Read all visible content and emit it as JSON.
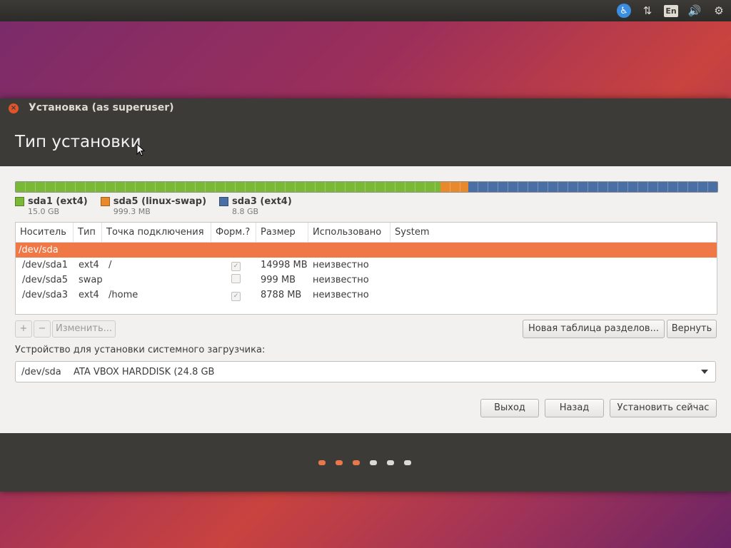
{
  "tray": {
    "accessibility_icon": "accessibility-icon",
    "network_icon": "network-arrows-icon",
    "language": "En",
    "volume_icon": "volume-icon",
    "settings_icon": "gear-icon"
  },
  "window": {
    "title": "Установка (as superuser)",
    "page_title": "Тип установки"
  },
  "partitions": [
    {
      "label": "sda1 (ext4)",
      "size": "15.0 GB",
      "color": "#7ab935",
      "fraction": 0.605
    },
    {
      "label": "sda5 (linux-swap)",
      "size": "999.3 MB",
      "color": "#e88a2b",
      "fraction": 0.04
    },
    {
      "label": "sda3 (ext4)",
      "size": "8.8 GB",
      "color": "#4a6fa5",
      "fraction": 0.355
    }
  ],
  "table": {
    "headers": [
      "Носитель",
      "Тип",
      "Точка подключения",
      "Форм.?",
      "Размер",
      "Использовано",
      "System"
    ],
    "device_row": "/dev/sda",
    "rows": [
      {
        "device": "/dev/sda1",
        "type": "ext4",
        "mount": "/",
        "format": true,
        "size": "14998 MB",
        "used": "неизвестно",
        "system": ""
      },
      {
        "device": "/dev/sda5",
        "type": "swap",
        "mount": "",
        "format": false,
        "size": "999 MB",
        "used": "неизвестно",
        "system": ""
      },
      {
        "device": "/dev/sda3",
        "type": "ext4",
        "mount": "/home",
        "format": true,
        "size": "8788 MB",
        "used": "неизвестно",
        "system": ""
      }
    ]
  },
  "buttons": {
    "add": "+",
    "remove": "−",
    "change": "Изменить...",
    "new_table": "Новая таблица разделов...",
    "revert": "Вернуть",
    "quit": "Выход",
    "back": "Назад",
    "install": "Установить сейчас"
  },
  "bootloader": {
    "label": "Устройство для установки системного загрузчика:",
    "device": "/dev/sda",
    "name": "ATA VBOX HARDDISK (24.8 GB"
  },
  "progress": {
    "total_steps": 6,
    "completed_steps": 3,
    "active_color": "#e9774a",
    "inactive_color": "#dcdad6"
  }
}
